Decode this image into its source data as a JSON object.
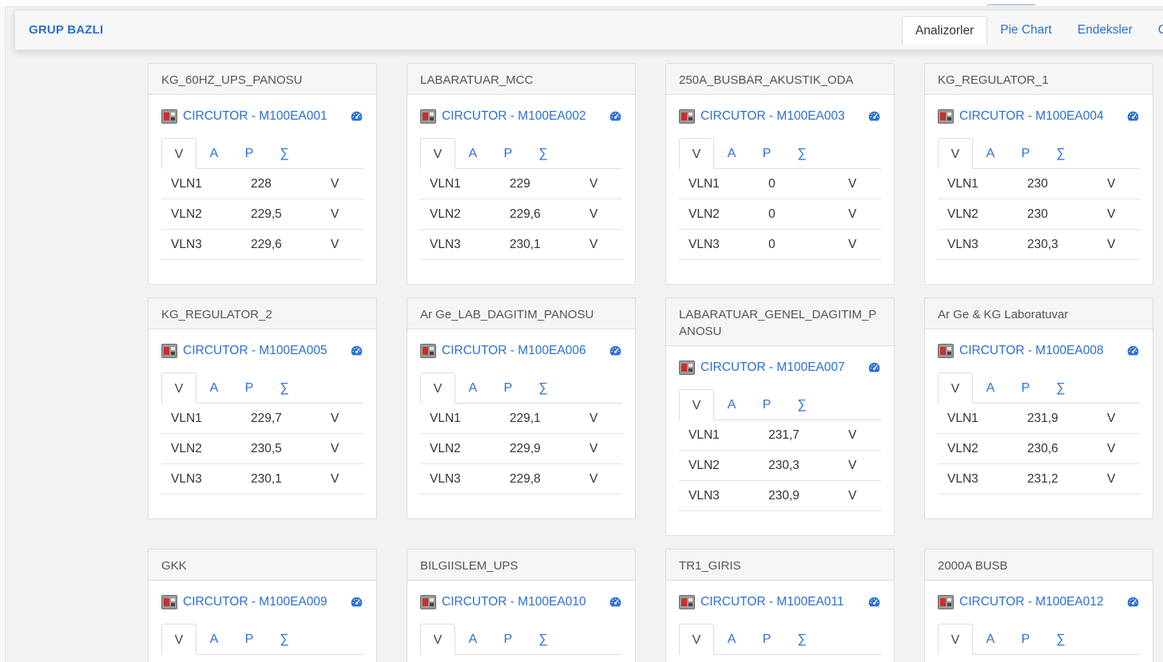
{
  "header": {
    "title": "GRUP BAZLI",
    "tabs": [
      {
        "label": "Analizorler",
        "active": true
      },
      {
        "label": "Pie Chart",
        "active": false
      },
      {
        "label": "Endeksler",
        "active": false
      },
      {
        "label": "C",
        "active": false
      }
    ]
  },
  "subtabs": [
    "V",
    "A",
    "P",
    "∑"
  ],
  "device_prefix": "CIRCUTOR - ",
  "unit": "V",
  "colors": {
    "accent": "#2a6fd6",
    "icon_red": "#c9302c"
  },
  "icons": {
    "device": "analyzer-device-icon",
    "detail": "gauge-icon"
  },
  "panels": [
    {
      "group": "KG_60HZ_UPS_PANOSU",
      "device": "CIRCUTOR - M100EA001",
      "rows": [
        {
          "name": "VLN1",
          "value": "228",
          "unit": "V"
        },
        {
          "name": "VLN2",
          "value": "229,5",
          "unit": "V"
        },
        {
          "name": "VLN3",
          "value": "229,6",
          "unit": "V"
        }
      ]
    },
    {
      "group": "LABARATUAR_MCC",
      "device": "CIRCUTOR - M100EA002",
      "rows": [
        {
          "name": "VLN1",
          "value": "229",
          "unit": "V"
        },
        {
          "name": "VLN2",
          "value": "229,6",
          "unit": "V"
        },
        {
          "name": "VLN3",
          "value": "230,1",
          "unit": "V"
        }
      ]
    },
    {
      "group": "250A_BUSBAR_AKUSTIK_ODA",
      "device": "CIRCUTOR - M100EA003",
      "rows": [
        {
          "name": "VLN1",
          "value": "0",
          "unit": "V"
        },
        {
          "name": "VLN2",
          "value": "0",
          "unit": "V"
        },
        {
          "name": "VLN3",
          "value": "0",
          "unit": "V"
        }
      ]
    },
    {
      "group": "KG_REGULATOR_1",
      "device": "CIRCUTOR - M100EA004",
      "rows": [
        {
          "name": "VLN1",
          "value": "230",
          "unit": "V"
        },
        {
          "name": "VLN2",
          "value": "230",
          "unit": "V"
        },
        {
          "name": "VLN3",
          "value": "230,3",
          "unit": "V"
        }
      ]
    },
    {
      "group": "KG_REGULATOR_2",
      "device": "CIRCUTOR - M100EA005",
      "rows": [
        {
          "name": "VLN1",
          "value": "229,7",
          "unit": "V"
        },
        {
          "name": "VLN2",
          "value": "230,5",
          "unit": "V"
        },
        {
          "name": "VLN3",
          "value": "230,1",
          "unit": "V"
        }
      ]
    },
    {
      "group": "Ar Ge_LAB_DAGITIM_PANOSU",
      "device": "CIRCUTOR - M100EA006",
      "rows": [
        {
          "name": "VLN1",
          "value": "229,1",
          "unit": "V"
        },
        {
          "name": "VLN2",
          "value": "229,9",
          "unit": "V"
        },
        {
          "name": "VLN3",
          "value": "229,8",
          "unit": "V"
        }
      ]
    },
    {
      "group": "LABARATUAR_GENEL_DAGITIM_PANOSU",
      "device": "CIRCUTOR - M100EA007",
      "rows": [
        {
          "name": "VLN1",
          "value": "231,7",
          "unit": "V"
        },
        {
          "name": "VLN2",
          "value": "230,3",
          "unit": "V"
        },
        {
          "name": "VLN3",
          "value": "230,9",
          "unit": "V"
        }
      ]
    },
    {
      "group": "Ar Ge & KG Laboratuvar",
      "device": "CIRCUTOR - M100EA008",
      "rows": [
        {
          "name": "VLN1",
          "value": "231,9",
          "unit": "V"
        },
        {
          "name": "VLN2",
          "value": "230,6",
          "unit": "V"
        },
        {
          "name": "VLN3",
          "value": "231,2",
          "unit": "V"
        }
      ]
    },
    {
      "group": "GKK",
      "device": "CIRCUTOR - M100EA009",
      "rows": []
    },
    {
      "group": "BILGIISLEM_UPS",
      "device": "CIRCUTOR - M100EA010",
      "rows": []
    },
    {
      "group": "TR1_GIRIS",
      "device": "CIRCUTOR - M100EA011",
      "rows": []
    },
    {
      "group": "2000A BUSB",
      "device": "CIRCUTOR - M100EA012",
      "rows": []
    }
  ]
}
